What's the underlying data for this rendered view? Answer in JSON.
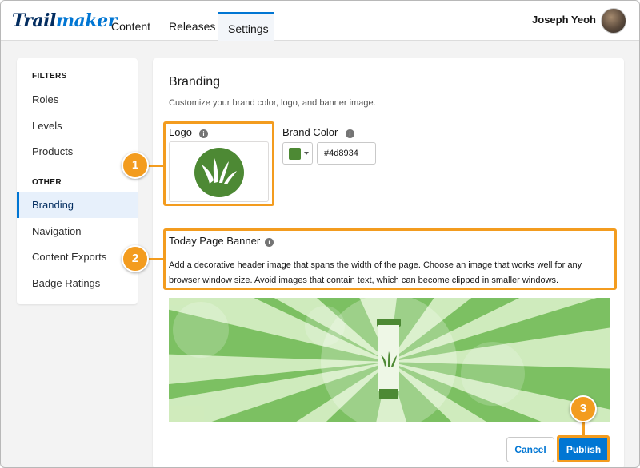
{
  "app": {
    "brand_left": "Trail",
    "brand_right": "maker",
    "nav": [
      {
        "label": "Content",
        "active": false
      },
      {
        "label": "Releases",
        "active": false
      },
      {
        "label": "Settings",
        "active": true
      }
    ],
    "user_name": "Joseph Yeoh"
  },
  "sidebar": {
    "section_filters": "FILTERS",
    "filters": [
      "Roles",
      "Levels",
      "Products"
    ],
    "section_other": "OTHER",
    "other": [
      {
        "label": "Branding",
        "active": true
      },
      {
        "label": "Navigation",
        "active": false
      },
      {
        "label": "Content Exports",
        "active": false
      },
      {
        "label": "Badge Ratings",
        "active": false
      }
    ]
  },
  "branding": {
    "title": "Branding",
    "subtitle": "Customize your brand color, logo, and banner image.",
    "logo_label": "Logo",
    "brand_color_label": "Brand Color",
    "brand_color_value": "#4d8934",
    "banner_label": "Today Page Banner",
    "banner_description": "Add a decorative header image that spans the width of the page. Choose an image that works well for any browser window size. Avoid images that contain text, which can become clipped in smaller windows.",
    "cancel_label": "Cancel",
    "publish_label": "Publish"
  },
  "callouts": [
    "1",
    "2",
    "3"
  ],
  "icons": {
    "info": "info-icon",
    "caret": "chevron-down-icon",
    "logo": "grass-logo-icon",
    "banner_product": "tube-icon"
  },
  "colors": {
    "accent": "#0176d3",
    "brand_green": "#4d8934",
    "callout": "#f39c1f",
    "banner_light": "#d9f0c7",
    "banner_dark": "#7cc062"
  }
}
